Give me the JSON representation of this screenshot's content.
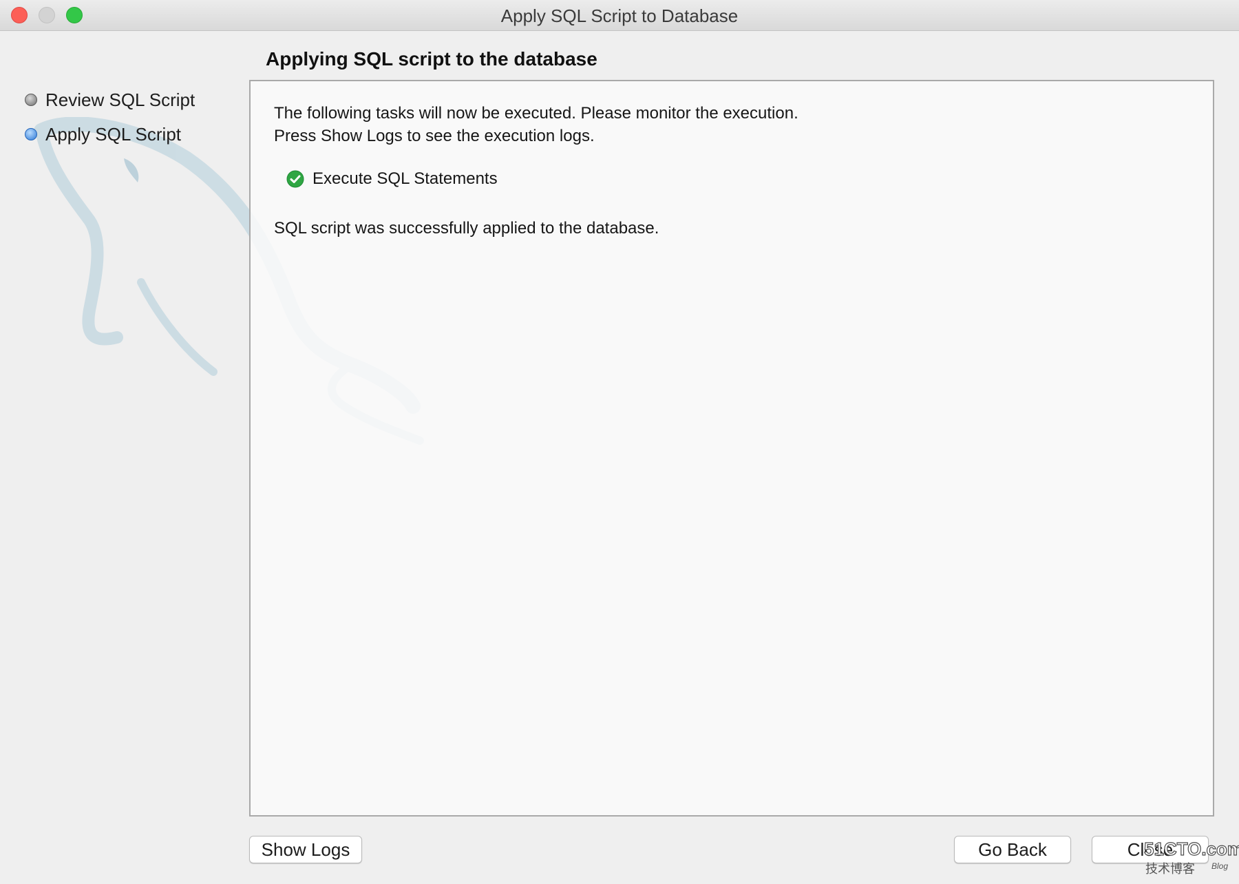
{
  "window": {
    "title": "Apply SQL Script to Database"
  },
  "steps": [
    {
      "label": "Review SQL Script",
      "state": "done"
    },
    {
      "label": "Apply SQL Script",
      "state": "active"
    }
  ],
  "main": {
    "heading": "Applying SQL script to the database",
    "intro_line1": "The following tasks will now be executed. Please monitor the execution.",
    "intro_line2": "Press Show Logs to see the execution logs.",
    "task": {
      "label": "Execute SQL Statements",
      "status": "success",
      "icon": "check-circle-icon"
    },
    "result": "SQL script was successfully applied to the database."
  },
  "buttons": {
    "show_logs": "Show Logs",
    "go_back": "Go Back",
    "close": "Close"
  },
  "watermark": {
    "line1": "51CTO.com",
    "line2": "技术博客",
    "line3": "Blog"
  },
  "colors": {
    "close": "#fc5f57",
    "minimize": "#d3d3d3",
    "zoom": "#33c748",
    "active_step": "#2e79d6",
    "success": "#2fa643"
  }
}
